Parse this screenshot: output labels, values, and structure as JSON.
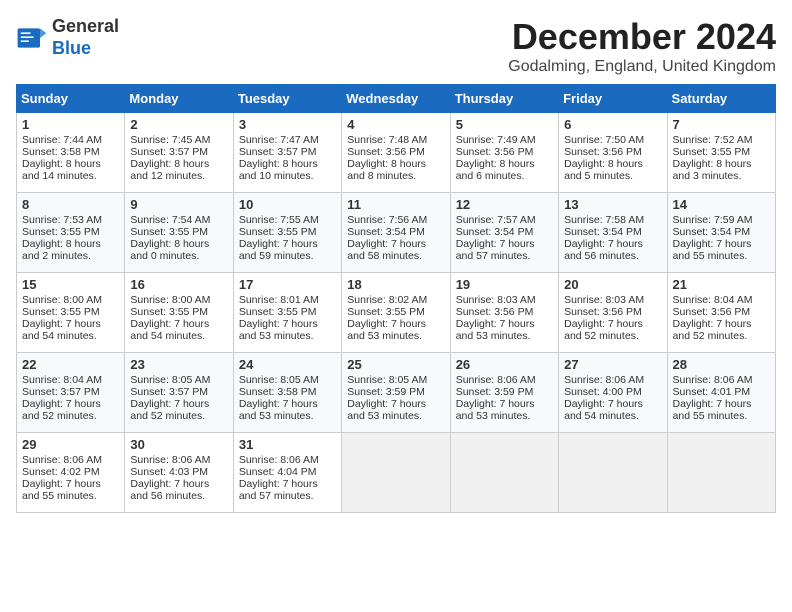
{
  "logo": {
    "line1": "General",
    "line2": "Blue"
  },
  "title": "December 2024",
  "location": "Godalming, England, United Kingdom",
  "weekdays": [
    "Sunday",
    "Monday",
    "Tuesday",
    "Wednesday",
    "Thursday",
    "Friday",
    "Saturday"
  ],
  "weeks": [
    [
      {
        "day": "1",
        "sunrise": "7:44 AM",
        "sunset": "3:58 PM",
        "daylight": "8 hours and 14 minutes."
      },
      {
        "day": "2",
        "sunrise": "7:45 AM",
        "sunset": "3:57 PM",
        "daylight": "8 hours and 12 minutes."
      },
      {
        "day": "3",
        "sunrise": "7:47 AM",
        "sunset": "3:57 PM",
        "daylight": "8 hours and 10 minutes."
      },
      {
        "day": "4",
        "sunrise": "7:48 AM",
        "sunset": "3:56 PM",
        "daylight": "8 hours and 8 minutes."
      },
      {
        "day": "5",
        "sunrise": "7:49 AM",
        "sunset": "3:56 PM",
        "daylight": "8 hours and 6 minutes."
      },
      {
        "day": "6",
        "sunrise": "7:50 AM",
        "sunset": "3:56 PM",
        "daylight": "8 hours and 5 minutes."
      },
      {
        "day": "7",
        "sunrise": "7:52 AM",
        "sunset": "3:55 PM",
        "daylight": "8 hours and 3 minutes."
      }
    ],
    [
      {
        "day": "8",
        "sunrise": "7:53 AM",
        "sunset": "3:55 PM",
        "daylight": "8 hours and 2 minutes."
      },
      {
        "day": "9",
        "sunrise": "7:54 AM",
        "sunset": "3:55 PM",
        "daylight": "8 hours and 0 minutes."
      },
      {
        "day": "10",
        "sunrise": "7:55 AM",
        "sunset": "3:55 PM",
        "daylight": "7 hours and 59 minutes."
      },
      {
        "day": "11",
        "sunrise": "7:56 AM",
        "sunset": "3:54 PM",
        "daylight": "7 hours and 58 minutes."
      },
      {
        "day": "12",
        "sunrise": "7:57 AM",
        "sunset": "3:54 PM",
        "daylight": "7 hours and 57 minutes."
      },
      {
        "day": "13",
        "sunrise": "7:58 AM",
        "sunset": "3:54 PM",
        "daylight": "7 hours and 56 minutes."
      },
      {
        "day": "14",
        "sunrise": "7:59 AM",
        "sunset": "3:54 PM",
        "daylight": "7 hours and 55 minutes."
      }
    ],
    [
      {
        "day": "15",
        "sunrise": "8:00 AM",
        "sunset": "3:55 PM",
        "daylight": "7 hours and 54 minutes."
      },
      {
        "day": "16",
        "sunrise": "8:00 AM",
        "sunset": "3:55 PM",
        "daylight": "7 hours and 54 minutes."
      },
      {
        "day": "17",
        "sunrise": "8:01 AM",
        "sunset": "3:55 PM",
        "daylight": "7 hours and 53 minutes."
      },
      {
        "day": "18",
        "sunrise": "8:02 AM",
        "sunset": "3:55 PM",
        "daylight": "7 hours and 53 minutes."
      },
      {
        "day": "19",
        "sunrise": "8:03 AM",
        "sunset": "3:56 PM",
        "daylight": "7 hours and 53 minutes."
      },
      {
        "day": "20",
        "sunrise": "8:03 AM",
        "sunset": "3:56 PM",
        "daylight": "7 hours and 52 minutes."
      },
      {
        "day": "21",
        "sunrise": "8:04 AM",
        "sunset": "3:56 PM",
        "daylight": "7 hours and 52 minutes."
      }
    ],
    [
      {
        "day": "22",
        "sunrise": "8:04 AM",
        "sunset": "3:57 PM",
        "daylight": "7 hours and 52 minutes."
      },
      {
        "day": "23",
        "sunrise": "8:05 AM",
        "sunset": "3:57 PM",
        "daylight": "7 hours and 52 minutes."
      },
      {
        "day": "24",
        "sunrise": "8:05 AM",
        "sunset": "3:58 PM",
        "daylight": "7 hours and 53 minutes."
      },
      {
        "day": "25",
        "sunrise": "8:05 AM",
        "sunset": "3:59 PM",
        "daylight": "7 hours and 53 minutes."
      },
      {
        "day": "26",
        "sunrise": "8:06 AM",
        "sunset": "3:59 PM",
        "daylight": "7 hours and 53 minutes."
      },
      {
        "day": "27",
        "sunrise": "8:06 AM",
        "sunset": "4:00 PM",
        "daylight": "7 hours and 54 minutes."
      },
      {
        "day": "28",
        "sunrise": "8:06 AM",
        "sunset": "4:01 PM",
        "daylight": "7 hours and 55 minutes."
      }
    ],
    [
      {
        "day": "29",
        "sunrise": "8:06 AM",
        "sunset": "4:02 PM",
        "daylight": "7 hours and 55 minutes."
      },
      {
        "day": "30",
        "sunrise": "8:06 AM",
        "sunset": "4:03 PM",
        "daylight": "7 hours and 56 minutes."
      },
      {
        "day": "31",
        "sunrise": "8:06 AM",
        "sunset": "4:04 PM",
        "daylight": "7 hours and 57 minutes."
      },
      null,
      null,
      null,
      null
    ]
  ]
}
